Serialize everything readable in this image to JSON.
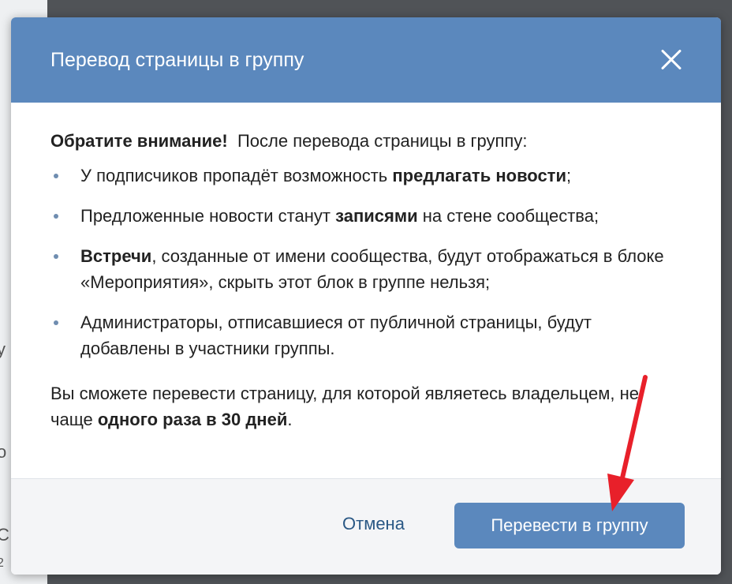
{
  "background": {
    "fragments": [
      "у",
      "о",
      "С",
      "2"
    ]
  },
  "modal": {
    "title": "Перевод страницы в группу",
    "intro_bold": "Обратите внимание!",
    "intro_text": "  После перевода страницы в группу:",
    "bullets": [
      {
        "parts": [
          "У подписчиков пропадёт возможность ",
          "предлагать новости",
          ";"
        ]
      },
      {
        "parts": [
          "Предложенные новости станут ",
          "записями",
          " на стене сообщества;"
        ]
      },
      {
        "parts": [
          "",
          "Встречи",
          ", созданные от имени сообщества, будут отображаться в блоке «Мероприятия», скрыть этот блок в группе нельзя;"
        ]
      },
      {
        "parts": [
          "Администраторы, отписавшиеся от публичной страницы, будут добавлены в участники группы.",
          "",
          ""
        ]
      }
    ],
    "note_prefix": "Вы сможете перевести страницу, для которой являетесь владельцем, не чаще ",
    "note_bold": "одного раза в 30 дней",
    "note_suffix": ".",
    "cancel_label": "Отмена",
    "submit_label": "Перевести в группу"
  },
  "icons": {
    "close": "close-icon",
    "bullet": "bullet-dot-icon",
    "arrow": "red-arrow-annotation"
  },
  "colors": {
    "header": "#5b88bd",
    "button": "#5b88bd",
    "link": "#2a5885",
    "arrow": "#e8202a"
  }
}
